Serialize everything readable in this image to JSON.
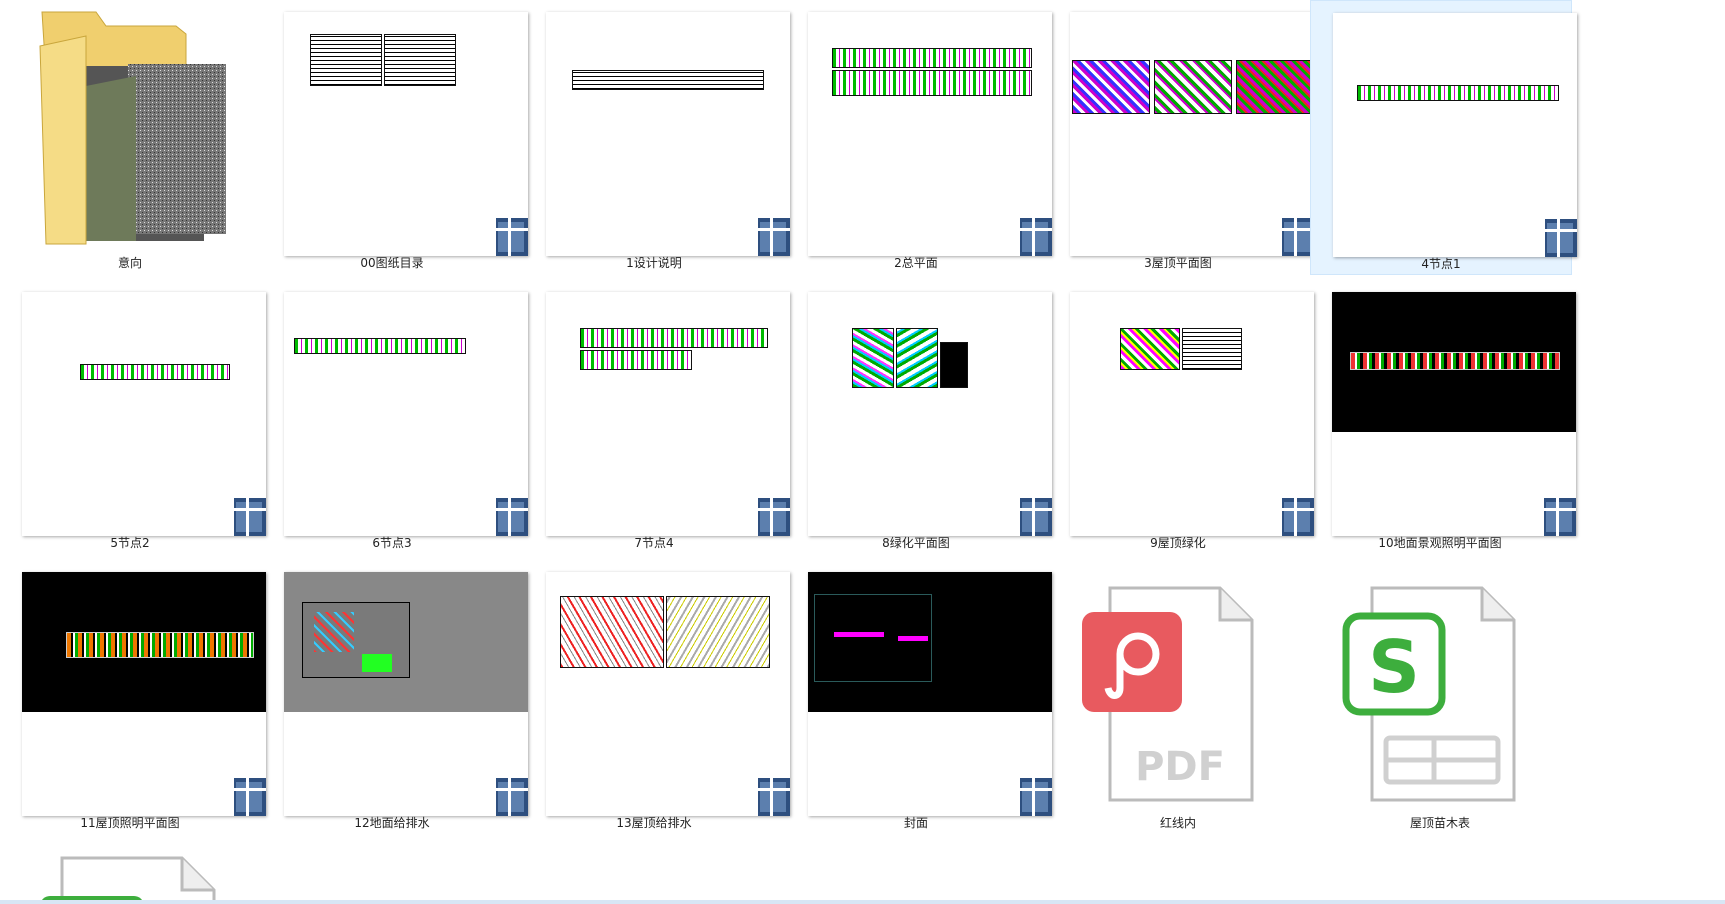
{
  "items": [
    {
      "label": "意向",
      "type": "folder"
    },
    {
      "label": "00图纸目录",
      "type": "dwg"
    },
    {
      "label": "1设计说明",
      "type": "dwg"
    },
    {
      "label": "2总平面",
      "type": "dwg"
    },
    {
      "label": "3屋顶平面图",
      "type": "dwg"
    },
    {
      "label": "4节点1",
      "type": "dwg",
      "selected": true
    },
    {
      "label": "5节点2",
      "type": "dwg"
    },
    {
      "label": "6节点3",
      "type": "dwg"
    },
    {
      "label": "7节点4",
      "type": "dwg"
    },
    {
      "label": "8绿化平面图",
      "type": "dwg"
    },
    {
      "label": "9屋顶绿化",
      "type": "dwg"
    },
    {
      "label": "10地面景观照明平面图",
      "type": "dwg"
    },
    {
      "label": "11屋顶照明平面图",
      "type": "dwg"
    },
    {
      "label": "12地面给排水",
      "type": "dwg"
    },
    {
      "label": "13屋顶给排水",
      "type": "dwg"
    },
    {
      "label": "封面",
      "type": "dwg"
    },
    {
      "label": "红线内",
      "type": "pdf",
      "icon_text": "PDF"
    },
    {
      "label": "屋顶苗木表",
      "type": "xls"
    }
  ],
  "colors": {
    "pdf_accent": "#e85a5f",
    "xls_accent": "#3dae3d",
    "dwg_badge": "#2e4f7f"
  }
}
